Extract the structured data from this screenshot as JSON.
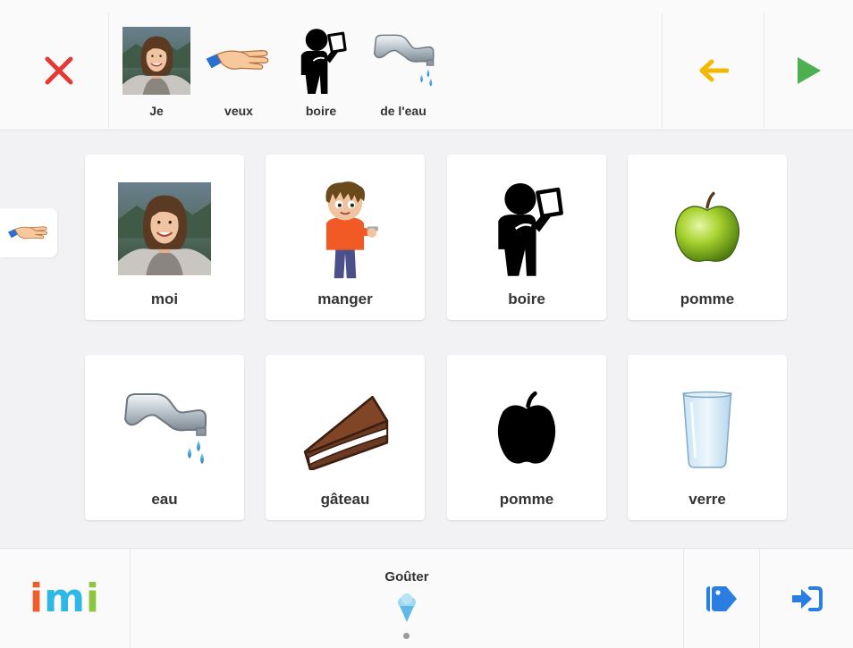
{
  "sentence": {
    "words": [
      {
        "label": "Je",
        "icon": "photo-woman-icon"
      },
      {
        "label": "veux",
        "icon": "hand-offering-icon"
      },
      {
        "label": "boire",
        "icon": "person-drinking-icon"
      },
      {
        "label": "de l'eau",
        "icon": "water-tap-icon"
      }
    ]
  },
  "grid": {
    "items": [
      {
        "label": "moi",
        "icon": "photo-woman-icon"
      },
      {
        "label": "manger",
        "icon": "boy-eating-icon"
      },
      {
        "label": "boire",
        "icon": "person-drinking-icon"
      },
      {
        "label": "pomme",
        "icon": "green-apple-icon"
      },
      {
        "label": "eau",
        "icon": "water-tap-icon"
      },
      {
        "label": "gâteau",
        "icon": "cake-slice-icon"
      },
      {
        "label": "pomme",
        "icon": "apple-silhouette-icon"
      },
      {
        "label": "verre",
        "icon": "glass-icon"
      }
    ]
  },
  "category": {
    "title": "Goûter",
    "icon": "ice-cream-icon"
  },
  "logo": {
    "text": "imi",
    "colors": [
      "#f15a29",
      "#2eb8e6",
      "#8dc63f"
    ]
  },
  "colors": {
    "close": "#e53935",
    "back": "#f5b800",
    "play": "#4caf50",
    "accent": "#2a7de1",
    "background": "#f2f2f4"
  }
}
